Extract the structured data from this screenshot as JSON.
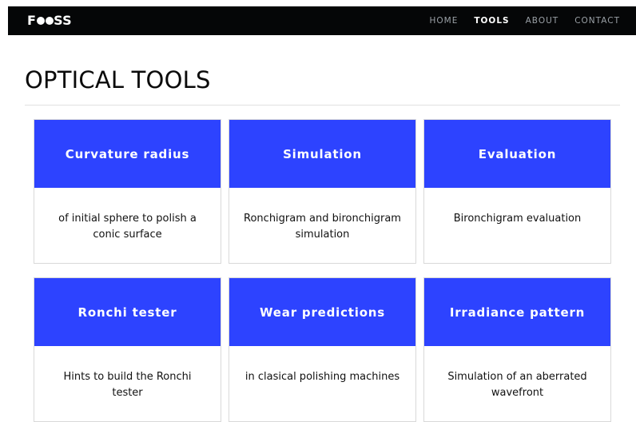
{
  "navbar": {
    "brand_prefix": "F",
    "brand_suffix": "SS",
    "links": [
      {
        "label": "HOME",
        "active": false
      },
      {
        "label": "TOOLS",
        "active": true
      },
      {
        "label": "ABOUT",
        "active": false
      },
      {
        "label": "CONTACT",
        "active": false
      }
    ]
  },
  "page": {
    "title": "OPTICAL TOOLS"
  },
  "tools": [
    {
      "title": "Curvature radius",
      "description": "of initial sphere to polish a conic surface"
    },
    {
      "title": "Simulation",
      "description": "Ronchigram and bironchigram simulation"
    },
    {
      "title": "Evaluation",
      "description": "Bironchigram evaluation"
    },
    {
      "title": "Ronchi tester",
      "description": "Hints to build the Ronchi tester"
    },
    {
      "title": "Wear predictions",
      "description": "in clasical polishing machines"
    },
    {
      "title": "Irradiance pattern",
      "description": "Simulation of an aberrated wavefront"
    }
  ],
  "colors": {
    "nav_background": "#050607",
    "nav_inactive": "#9aa0a6",
    "nav_active": "#ffffff",
    "card_header": "#2d43ff",
    "card_border": "#d9d9d9",
    "divider": "#e1e1e1"
  }
}
